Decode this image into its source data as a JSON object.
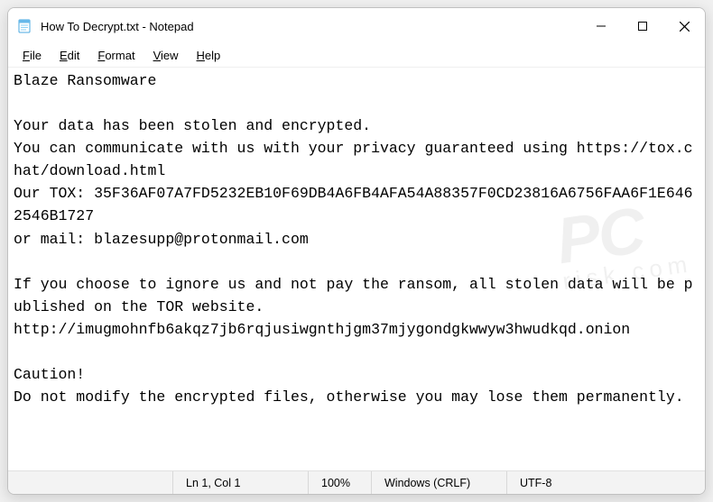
{
  "window": {
    "title": "How To Decrypt.txt - Notepad"
  },
  "menu": {
    "file": "File",
    "edit": "Edit",
    "format": "Format",
    "view": "View",
    "help": "Help"
  },
  "content": "Blaze Ransomware\n\nYour data has been stolen and encrypted.\nYou can communicate with us with your privacy guaranteed using https://tox.chat/download.html\nOur TOX: 35F36AF07A7FD5232EB10F69DB4A6FB4AFA54A88357F0CD23816A6756FAA6F1E6462546B1727\nor mail: blazesupp@protonmail.com\n\nIf you choose to ignore us and not pay the ransom, all stolen data will be published on the TOR website.\nhttp://imugmohnfb6akqz7jb6rqjusiwgnthjgm37mjygondgkwwyw3hwudkqd.onion\n\nCaution!\nDo not modify the encrypted files, otherwise you may lose them permanently.",
  "status": {
    "lncol": "Ln 1, Col 1",
    "zoom": "100%",
    "eol": "Windows (CRLF)",
    "encoding": "UTF-8"
  },
  "watermark": {
    "main": "PC",
    "sub": "risk.com"
  }
}
